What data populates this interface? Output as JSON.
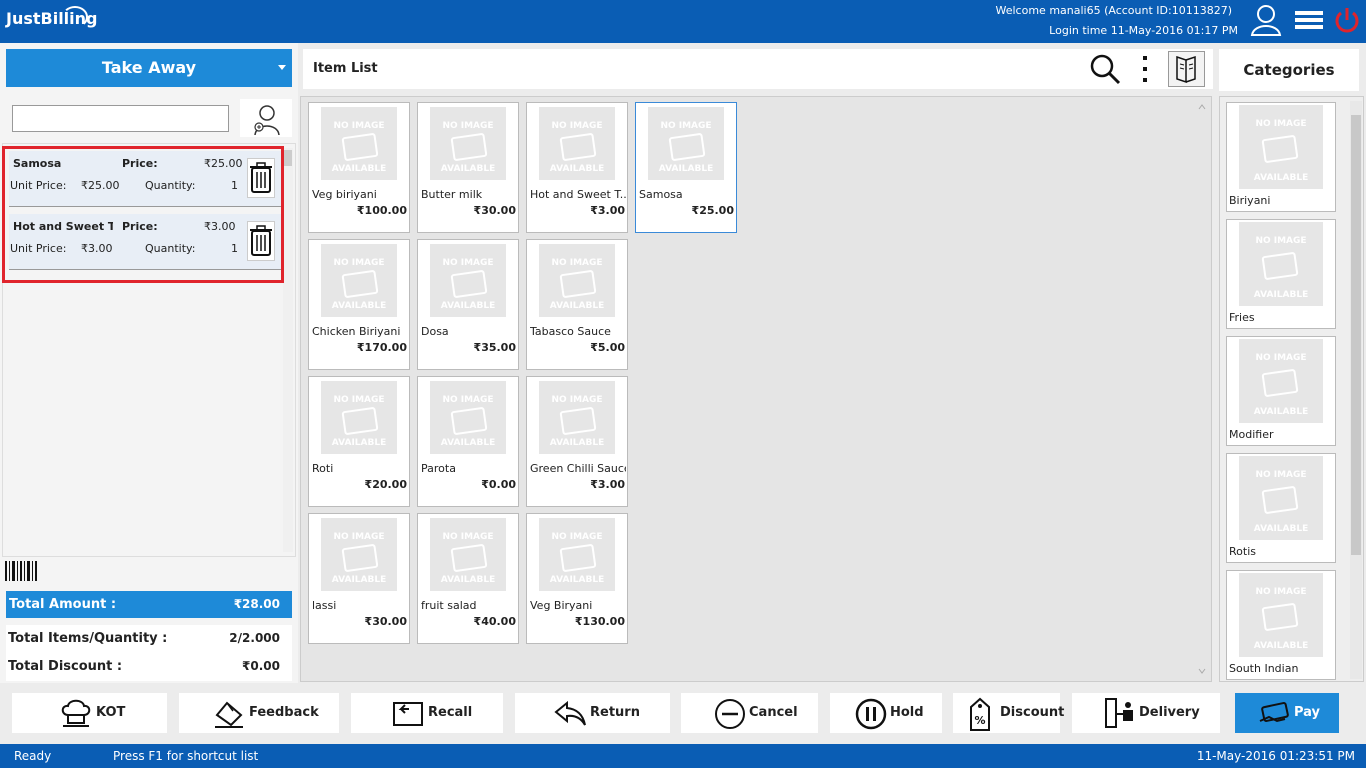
{
  "app": {
    "logo": "JustBilling"
  },
  "header": {
    "welcome": "Welcome manali65 (Account ID:10113827)",
    "login": "Login time  11-May-2016 01:17 PM"
  },
  "order": {
    "type": "Take Away",
    "customer_value": ""
  },
  "cart": {
    "items": [
      {
        "name": "Samosa",
        "price_label": "Price:",
        "price": "₹25.00",
        "unit_label": "Unit Price:",
        "unit_price": "₹25.00",
        "qty_label": "Quantity:",
        "qty": "1"
      },
      {
        "name": "Hot and Sweet T...",
        "price_label": "Price:",
        "price": "₹3.00",
        "unit_label": "Unit Price:",
        "unit_price": "₹3.00",
        "qty_label": "Quantity:",
        "qty": "1"
      }
    ]
  },
  "totals": {
    "amount_label": "Total Amount :",
    "amount": "₹28.00",
    "items_label": "Total Items/Quantity :",
    "items": "2/2.000",
    "discount_label": "Total Discount :",
    "discount": "₹0.00"
  },
  "item_list": {
    "title": "Item List",
    "no_image_top": "NO IMAGE",
    "no_image_bottom": "AVAILABLE",
    "items": [
      {
        "name": "Veg biriyani",
        "price": "₹100.00"
      },
      {
        "name": "Butter milk",
        "price": "₹30.00"
      },
      {
        "name": "Hot and Sweet T...",
        "price": "₹3.00"
      },
      {
        "name": "Samosa",
        "price": "₹25.00",
        "selected": true
      },
      {
        "name": "Chicken Biriyani",
        "price": "₹170.00"
      },
      {
        "name": "Dosa",
        "price": "₹35.00"
      },
      {
        "name": "Tabasco Sauce",
        "price": "₹5.00"
      },
      {
        "name": "Roti",
        "price": "₹20.00"
      },
      {
        "name": "Parota",
        "price": "₹0.00"
      },
      {
        "name": "Green Chilli Sauce",
        "price": "₹3.00"
      },
      {
        "name": "lassi",
        "price": "₹30.00"
      },
      {
        "name": "fruit salad",
        "price": "₹40.00"
      },
      {
        "name": "Veg Biryani",
        "price": "₹130.00"
      }
    ]
  },
  "categories": {
    "title": "Categories",
    "items": [
      "Biriyani",
      "Fries",
      "Modifier",
      "Rotis",
      "South Indian"
    ]
  },
  "actions": {
    "kot": "KOT",
    "feedback": "Feedback",
    "recall": "Recall",
    "return": "Return",
    "cancel": "Cancel",
    "hold": "Hold",
    "discount": "Discount",
    "delivery": "Delivery",
    "pay": "Pay"
  },
  "status": {
    "state": "Ready",
    "hint": "Press F1 for shortcut list",
    "datetime": "11-May-2016 01:23:51 PM"
  },
  "colors": {
    "brand": "#0a5db4",
    "accent": "#1e8ad8",
    "highlight": "#e0242c"
  },
  "icons": [
    "user-icon",
    "hamburger-icon",
    "power-icon",
    "search-icon",
    "more-icon",
    "menu-book-icon",
    "trash-icon",
    "barcode-icon",
    "add-customer-icon"
  ]
}
